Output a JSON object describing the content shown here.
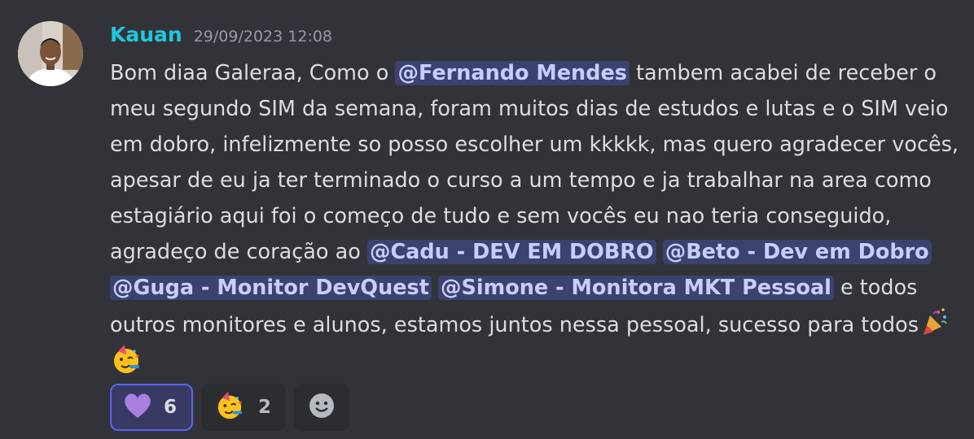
{
  "message": {
    "username": "Kauan",
    "timestamp": "29/09/2023 12:08",
    "segments": {
      "t1": "Bom diaa Galeraa, Como o ",
      "m1": "@Fernando Mendes",
      "t2": " tambem acabei de receber o meu segundo SIM da semana, foram muitos dias de estudos e lutas e o SIM veio em dobro, infelizmente so posso escolher um kkkkk, mas quero agradecer vocês, apesar de eu ja ter terminado o curso a um tempo e ja trabalhar na area como estagiário aqui foi o começo de tudo e sem vocês eu nao teria conseguido, agradeço de coração ao ",
      "m2": "@Cadu - DEV EM DOBRO",
      "t3": " ",
      "m3": "@Beto - Dev em Dobro",
      "t4": " ",
      "m4": "@Guga - Monitor DevQuest",
      "t5": " ",
      "m5": "@Simone - Monitora MKT Pessoal",
      "t6": " e todos outros monitores e alunos, estamos juntos nessa pessoal, sucesso para todos"
    },
    "inline_emojis": [
      "party-popper",
      "partying-face"
    ]
  },
  "reactions": [
    {
      "emoji": "purple-heart",
      "count": "6",
      "active": true
    },
    {
      "emoji": "partying-face",
      "count": "2",
      "active": false
    }
  ],
  "add_reaction_icon": "smiley-icon",
  "colors": {
    "background": "#313338",
    "username": "#1ec8dd",
    "mention_bg": "#3c4270",
    "mention_text": "#c9cdfb",
    "heart": "#a97fe0"
  }
}
